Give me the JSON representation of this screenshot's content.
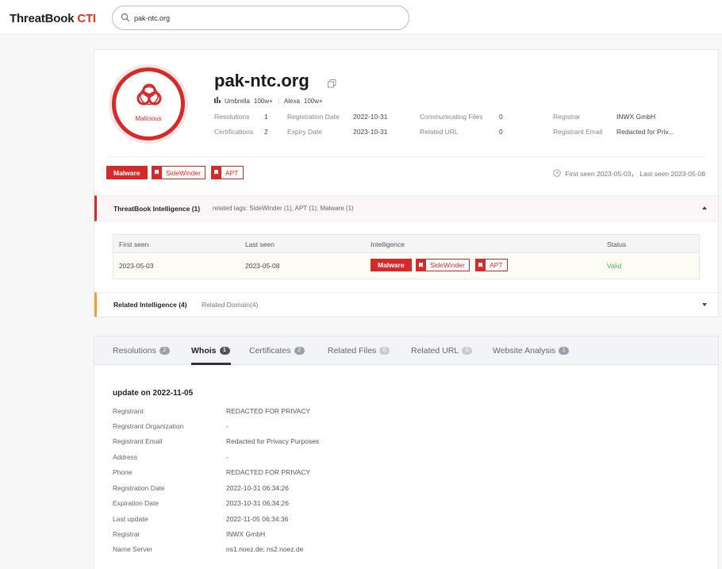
{
  "header": {
    "logo_main": "ThreatBook ",
    "logo_accent": "CTI",
    "search_value": "pak-ntc.org"
  },
  "summary": {
    "verdict": "Malicious",
    "domain": "pak-ntc.org",
    "umbrella_label": "Umbrella",
    "umbrella_value": "100w+",
    "alexa_label": "Alexa",
    "alexa_value": "100w+",
    "fields": {
      "resolutions_label": "Resolutions",
      "resolutions_value": "1",
      "certifications_label": "Certifications",
      "certifications_value": "2",
      "registration_date_label": "Registration Date",
      "registration_date_value": "2022-10-31",
      "expiry_date_label": "Expiry Date",
      "expiry_date_value": "2023-10-31",
      "communicating_files_label": "Communicating Files",
      "communicating_files_value": "0",
      "related_url_label": "Related URL",
      "related_url_value": "0",
      "registrar_label": "Registrar",
      "registrar_value": "INWX GmbH",
      "registrant_email_label": "Registrant Email",
      "registrant_email_value": "Redacted for Priv..."
    },
    "tags": {
      "malware": "Malware",
      "sidewinder": "SideWinder",
      "apt": "APT"
    },
    "seen_text": "First seen 2023-05-03， Last seen 2023-05-08"
  },
  "threatbook_intel": {
    "title": "ThreatBook Intelligence (1)",
    "related_tags": "related tags: SideWinder (1), APT (1), Malware (1)",
    "columns": [
      "First seen",
      "Last seen",
      "Intelligence",
      "Status"
    ],
    "row": {
      "first_seen": "2023-05-03",
      "last_seen": "2023-05-08",
      "tag_malware": "Malware",
      "tag_sidewinder": "SideWinder",
      "tag_apt": "APT",
      "status": "Valid"
    }
  },
  "related_intel": {
    "title": "Related Intelligence (4)",
    "sub": "Related Domain(4)"
  },
  "tabs": [
    {
      "label": "Resolutions",
      "count": "2"
    },
    {
      "label": "Whois",
      "count": "1"
    },
    {
      "label": "Certificates",
      "count": "2"
    },
    {
      "label": "Related Files",
      "count": "0"
    },
    {
      "label": "Related URL",
      "count": "0"
    },
    {
      "label": "Website Analysis",
      "count": "1"
    }
  ],
  "whois": {
    "update_title": "update on 2022-11-05",
    "rows": [
      {
        "label": "Registrant",
        "value": "REDACTED FOR PRIVACY"
      },
      {
        "label": "Registrant Organization",
        "value": "-"
      },
      {
        "label": "Registrant Email",
        "value": "Redacted for Privacy Purposes"
      },
      {
        "label": "Address",
        "value": "-"
      },
      {
        "label": "Phone",
        "value": "REDACTED FOR PRIVACY"
      },
      {
        "label": "Registration Date",
        "value": "2022-10-31 06:34:26"
      },
      {
        "label": "Expiration Date",
        "value": "2023-10-31 06:34:26"
      },
      {
        "label": "Last update",
        "value": "2022-11-05 06:34:36"
      },
      {
        "label": "Registrar",
        "value": "INWX GmbH"
      },
      {
        "label": "Name Server",
        "value": "ns1.noez.de; ns2.noez.de"
      }
    ]
  }
}
